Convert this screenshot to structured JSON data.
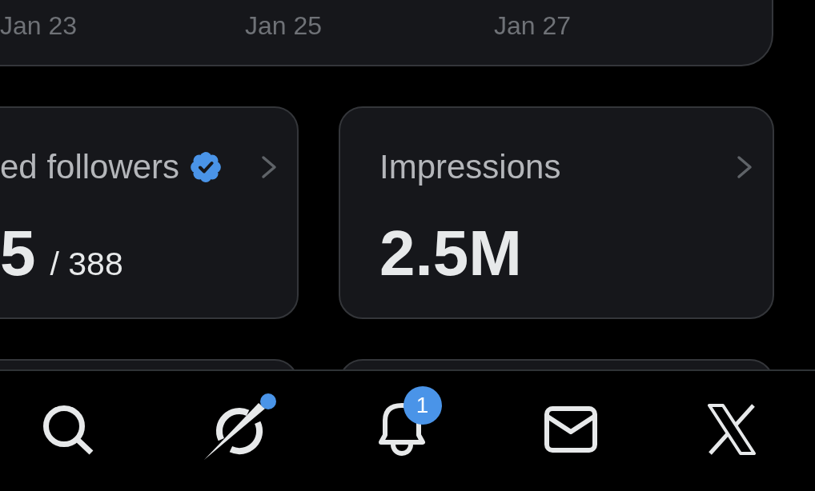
{
  "chart": {
    "x_labels": [
      "Jan 23",
      "Jan 25",
      "Jan 27"
    ]
  },
  "stats": [
    {
      "title": "ed followers",
      "verified": true,
      "value": "5",
      "total": "/ 388"
    },
    {
      "title": "Impressions",
      "verified": false,
      "value": "2.5M"
    }
  ],
  "nav": [
    {
      "kind": "search",
      "dot": false
    },
    {
      "kind": "orbit",
      "dot": true
    },
    {
      "kind": "bell",
      "dot": false,
      "badge": "1"
    },
    {
      "kind": "envelope",
      "dot": false
    },
    {
      "kind": "x",
      "dot": false
    }
  ]
}
